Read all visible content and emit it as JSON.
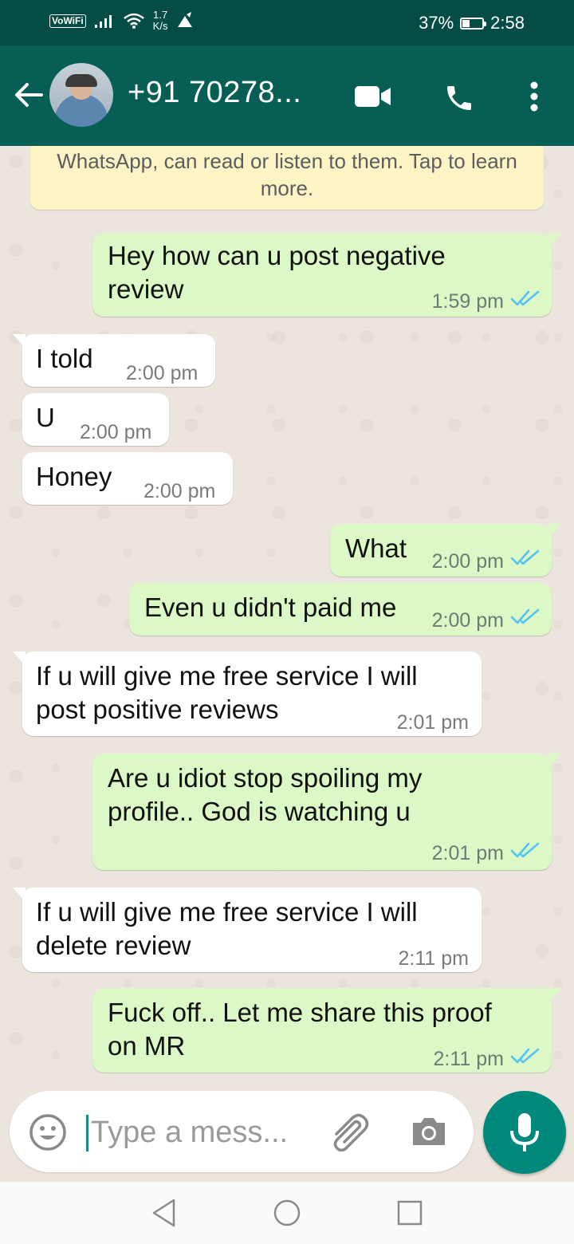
{
  "status_bar": {
    "network_label": "VoWiFi",
    "speed_value": "1.7",
    "speed_unit": "K/s",
    "battery_percent": "37%",
    "battery_level": 0.37,
    "time": "2:58"
  },
  "header": {
    "contact_name": "+91 70278...",
    "icons": [
      "back-arrow-icon",
      "video-call-icon",
      "phone-icon",
      "more-vert-icon"
    ]
  },
  "chat": {
    "encryption_notice": "WhatsApp, can read or listen to them. Tap to learn more.",
    "messages": [
      {
        "direction": "out",
        "text": "Hey how can u post negative\nreview",
        "time": "1:59 pm",
        "status": "read"
      },
      {
        "direction": "in",
        "text": "I told",
        "time": "2:00 pm"
      },
      {
        "direction": "in",
        "text": "U",
        "time": "2:00 pm"
      },
      {
        "direction": "in",
        "text": "Honey",
        "time": "2:00 pm"
      },
      {
        "direction": "out",
        "text": "What",
        "time": "2:00 pm",
        "status": "read"
      },
      {
        "direction": "out",
        "text": "Even u didn't paid me",
        "time": "2:00 pm",
        "status": "read"
      },
      {
        "direction": "in",
        "text": "If u will give me free service I will\npost positive reviews",
        "time": "2:01 pm"
      },
      {
        "direction": "out",
        "text": "Are u idiot stop spoiling my\nprofile.. God is watching u",
        "time": "2:01 pm",
        "status": "read"
      },
      {
        "direction": "in",
        "text": "If u will give me free service I will\ndelete review",
        "time": "2:11 pm"
      },
      {
        "direction": "out",
        "text": "Fuck off.. Let me share this proof\non MR",
        "time": "2:11 pm",
        "status": "read"
      }
    ]
  },
  "composer": {
    "placeholder": "Type a mess...",
    "icons": [
      "emoji-icon",
      "paperclip-icon",
      "camera-icon",
      "microphone-icon"
    ]
  },
  "colors": {
    "status_bar": "#054d44",
    "app_bar": "#075e54",
    "outgoing_bubble": "#dcf8c6",
    "incoming_bubble": "#ffffff",
    "read_ticks": "#4fc3f7",
    "mic_button": "#00897b",
    "chat_background": "#ece5dd"
  }
}
